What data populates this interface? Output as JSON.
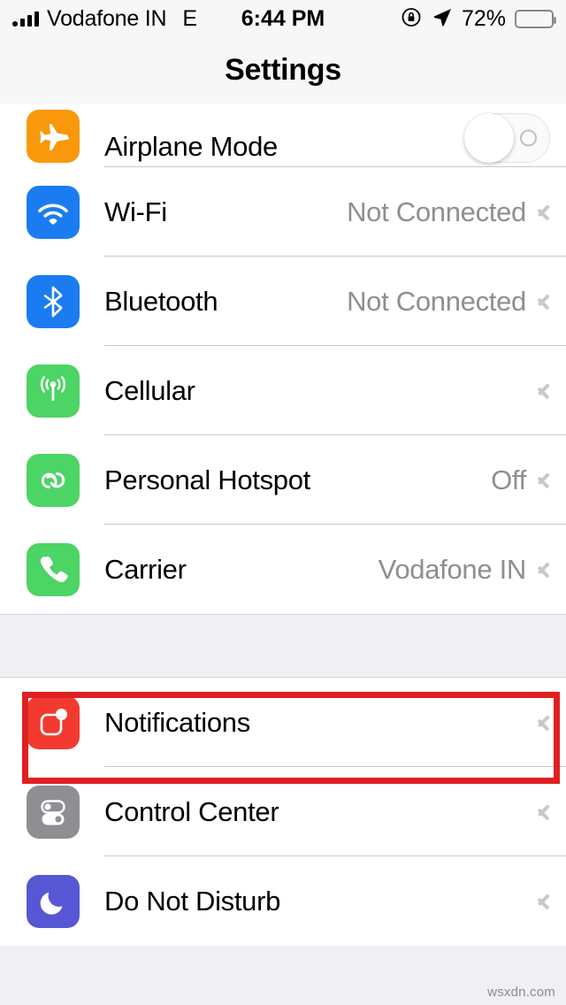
{
  "status_bar": {
    "carrier": "Vodafone IN",
    "network_type": "E",
    "time": "6:44 PM",
    "battery_percent": "72%",
    "battery_level": 72,
    "signal_bars": 4,
    "icons": [
      "signal-bars-icon",
      "rotation-lock-icon",
      "location-arrow-icon",
      "battery-icon"
    ]
  },
  "navbar": {
    "title": "Settings"
  },
  "groups": [
    {
      "id": "connectivity",
      "rows": [
        {
          "label": "Airplane Mode",
          "icon": "airplane-icon",
          "accessory": "toggle",
          "toggle_on": false,
          "value": "",
          "clipped": true
        },
        {
          "label": "Wi-Fi",
          "icon": "wifi-icon",
          "accessory": "chevron",
          "value": "Not Connected"
        },
        {
          "label": "Bluetooth",
          "icon": "bluetooth-icon",
          "accessory": "chevron",
          "value": "Not Connected"
        },
        {
          "label": "Cellular",
          "icon": "cellular-icon",
          "accessory": "chevron",
          "value": ""
        },
        {
          "label": "Personal Hotspot",
          "icon": "hotspot-icon",
          "accessory": "chevron",
          "value": "Off"
        },
        {
          "label": "Carrier",
          "icon": "phone-icon",
          "accessory": "chevron",
          "value": "Vodafone IN"
        }
      ]
    },
    {
      "id": "system",
      "rows": [
        {
          "label": "Notifications",
          "icon": "notifications-icon",
          "accessory": "chevron",
          "value": "",
          "highlighted": true
        },
        {
          "label": "Control Center",
          "icon": "control-center-icon",
          "accessory": "chevron",
          "value": ""
        },
        {
          "label": "Do Not Disturb",
          "icon": "do-not-disturb-icon",
          "accessory": "chevron",
          "value": ""
        }
      ]
    }
  ],
  "highlight": {
    "color": "#E02020",
    "target": "Notifications"
  },
  "watermark": "wsxdn.com",
  "colors": {
    "page_background": "#EFEFF4",
    "row_background": "#FFFFFF",
    "separator": "#C8C7CC",
    "secondary_text": "#8E8E93",
    "chevron": "#C7C7CC",
    "icon_airplane": "#F9980A",
    "icon_wifi": "#1A7CF0",
    "icon_bluetooth": "#1A7CF0",
    "icon_cellular": "#4CD464",
    "icon_hotspot": "#4CD464",
    "icon_phone": "#4CD464",
    "icon_notifications": "#F23A31",
    "icon_control_center": "#8E8E93",
    "icon_do_not_disturb": "#5756D5"
  }
}
